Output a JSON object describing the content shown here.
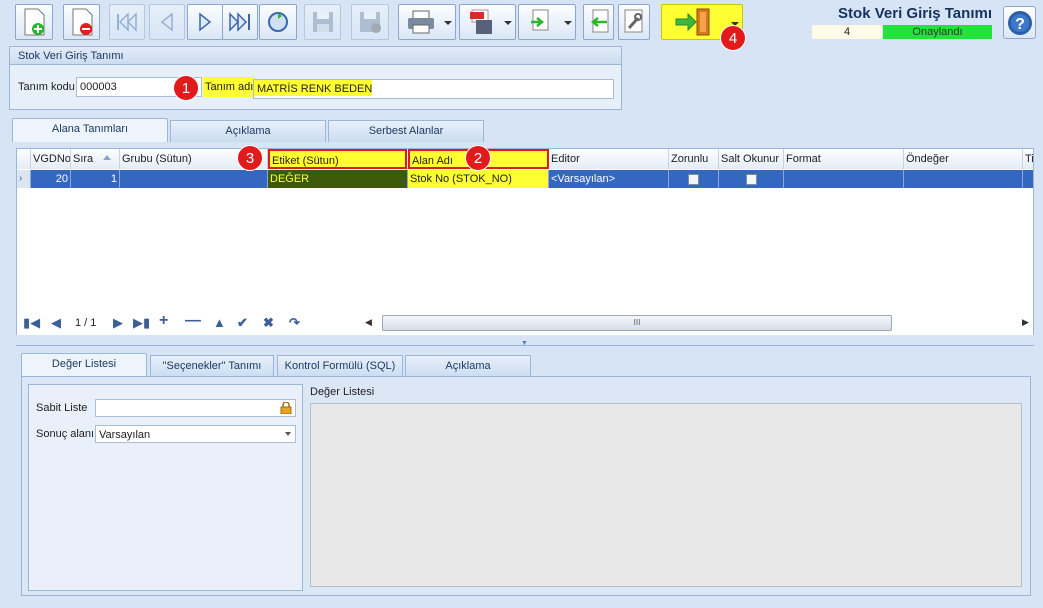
{
  "app": {
    "title": "Stok Veri Giriş Tanımı",
    "record_count": "4",
    "status": "Onaylandı",
    "status_color": "#22e33a",
    "accent": "#ffff33"
  },
  "toolbar": {
    "buttons": [
      "new-doc-icon",
      "delete-doc-icon",
      "first-record-icon",
      "prev-record-icon",
      "next-record-icon",
      "last-record-icon",
      "refresh-icon",
      "save-icon",
      "save-close-icon",
      "print-icon",
      "pdf-export-icon",
      "export-icon",
      "import-icon",
      "tools-icon",
      "exit-icon",
      "help-icon"
    ]
  },
  "header": {
    "group_label": "Stok Veri Giriş Tanımı",
    "code_label": "Tanım kodu",
    "code_value": "000003",
    "name_label": "Tanım adı",
    "name_value": "MATRİS RENK BEDEN"
  },
  "tabs_top": [
    "Alana Tanımları",
    "Açıklama",
    "Serbest Alanlar"
  ],
  "grid": {
    "columns": [
      "VGDNo",
      "Sıra",
      "Grubu (Sütun)",
      "Etiket (Sütun)",
      "Alan Adı",
      "Editor",
      "Zorunlu",
      "Salt Okunur",
      "Format",
      "Öndeğer",
      "Ti"
    ],
    "rows": [
      {
        "vgdno": "20",
        "sira": "1",
        "grubu": "",
        "etiket": "DEĞER",
        "alan_adi": "Stok No (STOK_NO)",
        "editor": "<Varsayılan>",
        "zorunlu": false,
        "salt_okunur": false,
        "format": "",
        "ondeger": ""
      }
    ],
    "pager": "1 / 1",
    "scroll_grip": "III"
  },
  "tabs_bottom": [
    "Değer Listesi",
    "\"Seçenekler\" Tanımı",
    "Kontrol Formülü (SQL)",
    "Açıklama"
  ],
  "detail": {
    "sabit_liste_label": "Sabit Liste",
    "sabit_liste_value": "",
    "sonuc_alani_label": "Sonuç alanı",
    "sonuc_alani_value": "Varsayılan",
    "deger_listesi_label": "Değer Listesi"
  },
  "badges": [
    "1",
    "2",
    "3",
    "4"
  ]
}
